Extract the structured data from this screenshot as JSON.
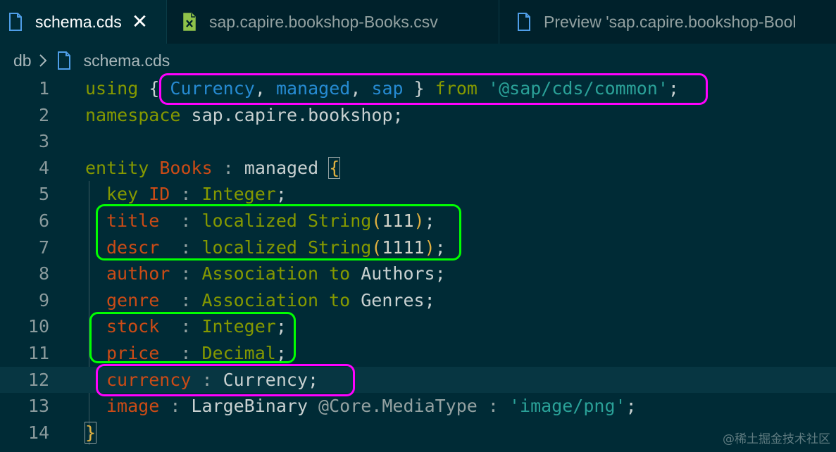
{
  "tabs": [
    {
      "label": "schema.cds",
      "icon": "file-icon",
      "close": "✕",
      "active": true
    },
    {
      "label": "sap.capire.bookshop-Books.csv",
      "icon": "spreadsheet-file-icon",
      "active": false
    },
    {
      "label": "Preview 'sap.capire.bookshop-Bool",
      "icon": "file-icon",
      "active": false
    }
  ],
  "breadcrumb": {
    "root": "db",
    "file": "schema.cds"
  },
  "editor": {
    "line_numbers": [
      "1",
      "2",
      "3",
      "4",
      "5",
      "6",
      "7",
      "8",
      "9",
      "10",
      "11",
      "12",
      "13",
      "14"
    ],
    "lines": {
      "l1": {
        "kw": "using",
        "lb": " {",
        "a": " Currency",
        "c1": ",",
        "b": " managed",
        "c2": ",",
        "c": " sap",
        "rb": " } ",
        "from": "from",
        "str": " '@sap/cds/common'",
        "semi": ";"
      },
      "l2": {
        "kw": "namespace",
        "rest": " sap.capire.bookshop;"
      },
      "l4": {
        "kw": "entity",
        "name": " Books",
        "colon": " :",
        "base": " managed ",
        "brace": "{"
      },
      "l5": {
        "kw": "key",
        "name": " ID",
        "colon": " :",
        "type": " Integer",
        "semi": ";"
      },
      "l6": {
        "name": "title",
        "colon": "  :",
        "kw": " localized",
        "type": " String",
        "open": "(",
        "num": "111",
        "close": ")",
        "semi": ";"
      },
      "l7": {
        "name": "descr",
        "colon": "  :",
        "kw": " localized",
        "type": " String",
        "open": "(",
        "num": "1111",
        "close": ")",
        "semi": ";"
      },
      "l8": {
        "name": "author",
        "colon": " :",
        "kw": " Association to",
        "target": " Authors",
        "semi": ";"
      },
      "l9": {
        "name": "genre",
        "colon": "  :",
        "kw": " Association to",
        "target": " Genres",
        "semi": ";"
      },
      "l10": {
        "name": "stock",
        "colon": "  :",
        "type": " Integer",
        "semi": ";"
      },
      "l11": {
        "name": "price",
        "colon": "  :",
        "type": " Decimal",
        "semi": ";"
      },
      "l12": {
        "name": "currency",
        "colon": " :",
        "type": " Currency",
        "semi": ";"
      },
      "l13": {
        "name": "image",
        "colon": " :",
        "type": " LargeBinary",
        "ann": " @Core.MediaType",
        "colon2": " :",
        "str": " 'image/png'",
        "semi": ";"
      },
      "l14": {
        "brace": "}"
      }
    }
  },
  "watermark": "@稀土掘金技术社区",
  "colors": {
    "background": "#002b36",
    "keyword": "#859900",
    "type": "#cb4b16",
    "identifier": "#268bd2",
    "string": "#2aa198",
    "highlight_magenta": "#ff00ff",
    "highlight_green": "#00ff00"
  }
}
